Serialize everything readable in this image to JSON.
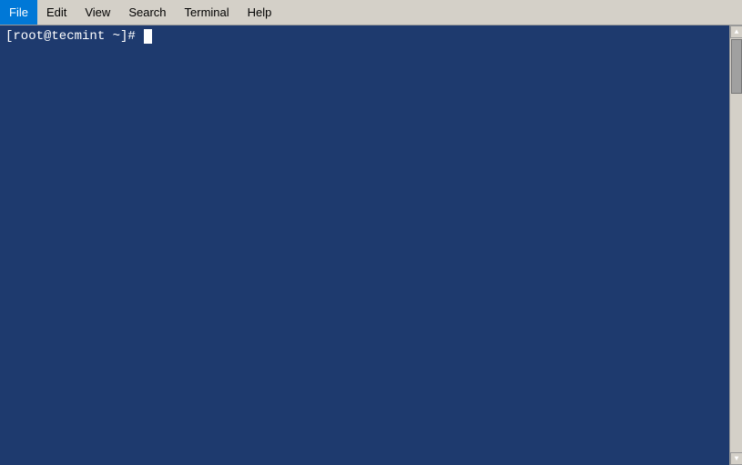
{
  "menubar": {
    "items": [
      {
        "id": "file",
        "label": "File"
      },
      {
        "id": "edit",
        "label": "Edit"
      },
      {
        "id": "view",
        "label": "View"
      },
      {
        "id": "search",
        "label": "Search"
      },
      {
        "id": "terminal",
        "label": "Terminal"
      },
      {
        "id": "help",
        "label": "Help"
      }
    ]
  },
  "terminal": {
    "prompt": "[root@tecmint ~]# "
  }
}
